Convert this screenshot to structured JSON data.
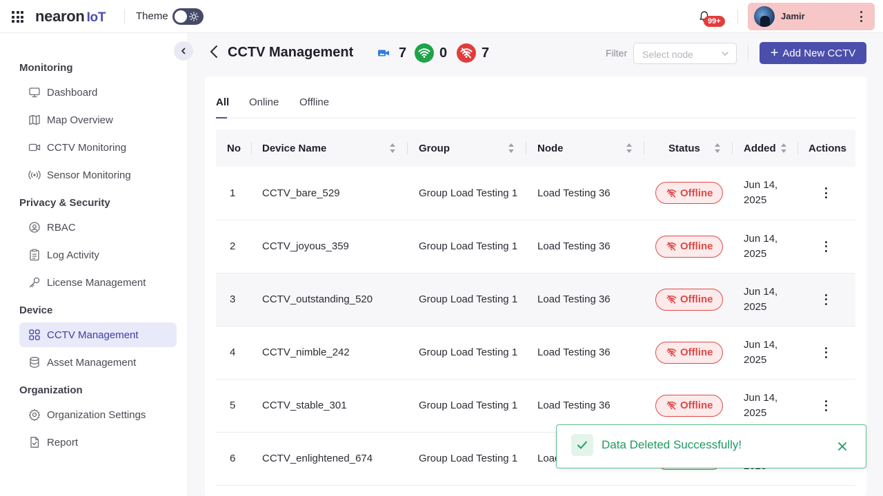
{
  "app": {
    "logo_main": "nearon",
    "logo_suffix": "IoT",
    "theme_label": "Theme",
    "notifications_badge": "99+",
    "user_name": "Jamir"
  },
  "sidebar": {
    "sections": [
      {
        "title": "Monitoring",
        "items": [
          {
            "label": "Dashboard",
            "icon": "monitor-icon"
          },
          {
            "label": "Map Overview",
            "icon": "map-icon"
          },
          {
            "label": "CCTV Monitoring",
            "icon": "video-camera-icon"
          },
          {
            "label": "Sensor Monitoring",
            "icon": "sensor-icon"
          }
        ]
      },
      {
        "title": "Privacy & Security",
        "items": [
          {
            "label": "RBAC",
            "icon": "rbac-icon"
          },
          {
            "label": "Log Activity",
            "icon": "log-icon"
          },
          {
            "label": "License Management",
            "icon": "key-icon"
          }
        ]
      },
      {
        "title": "Device",
        "items": [
          {
            "label": "CCTV Management",
            "icon": "grid-icon",
            "active": true
          },
          {
            "label": "Asset Management",
            "icon": "database-icon"
          }
        ]
      },
      {
        "title": "Organization",
        "items": [
          {
            "label": "Organization Settings",
            "icon": "gear-icon"
          },
          {
            "label": "Report",
            "icon": "report-icon"
          }
        ]
      }
    ]
  },
  "header": {
    "title": "CCTV Management",
    "stats": {
      "total": "7",
      "online": "0",
      "offline": "7"
    },
    "filter_label": "Filter",
    "filter_placeholder": "Select node",
    "add_button": "Add New CCTV"
  },
  "tabs": [
    "All",
    "Online",
    "Offline"
  ],
  "table": {
    "columns": [
      "No",
      "Device Name",
      "Group",
      "Node",
      "Status",
      "Added",
      "Actions"
    ],
    "rows": [
      {
        "no": "1",
        "name": "CCTV_bare_529",
        "group": "Group Load Testing 1",
        "node": "Load Testing 36",
        "status": "Offline",
        "date1": "Jun 14,",
        "date2": "2025"
      },
      {
        "no": "2",
        "name": "CCTV_joyous_359",
        "group": "Group Load Testing 1",
        "node": "Load Testing 36",
        "status": "Offline",
        "date1": "Jun 14,",
        "date2": "2025"
      },
      {
        "no": "3",
        "name": "CCTV_outstanding_520",
        "group": "Group Load Testing 1",
        "node": "Load Testing 36",
        "status": "Offline",
        "date1": "Jun 14,",
        "date2": "2025"
      },
      {
        "no": "4",
        "name": "CCTV_nimble_242",
        "group": "Group Load Testing 1",
        "node": "Load Testing 36",
        "status": "Offline",
        "date1": "Jun 14,",
        "date2": "2025"
      },
      {
        "no": "5",
        "name": "CCTV_stable_301",
        "group": "Group Load Testing 1",
        "node": "Load Testing 36",
        "status": "Offline",
        "date1": "Jun 14,",
        "date2": "2025"
      },
      {
        "no": "6",
        "name": "CCTV_enlightened_674",
        "group": "Group Load Testing 1",
        "node": "Load Testing 36",
        "status": "Offline",
        "date1": "Jun 14,",
        "date2": "2025"
      }
    ]
  },
  "toast": {
    "message": "Data Deleted Successfully!"
  },
  "colors": {
    "primary": "#4b4eab",
    "offline": "#e04848",
    "online": "#1fa34a",
    "success": "#1f9a5e"
  }
}
